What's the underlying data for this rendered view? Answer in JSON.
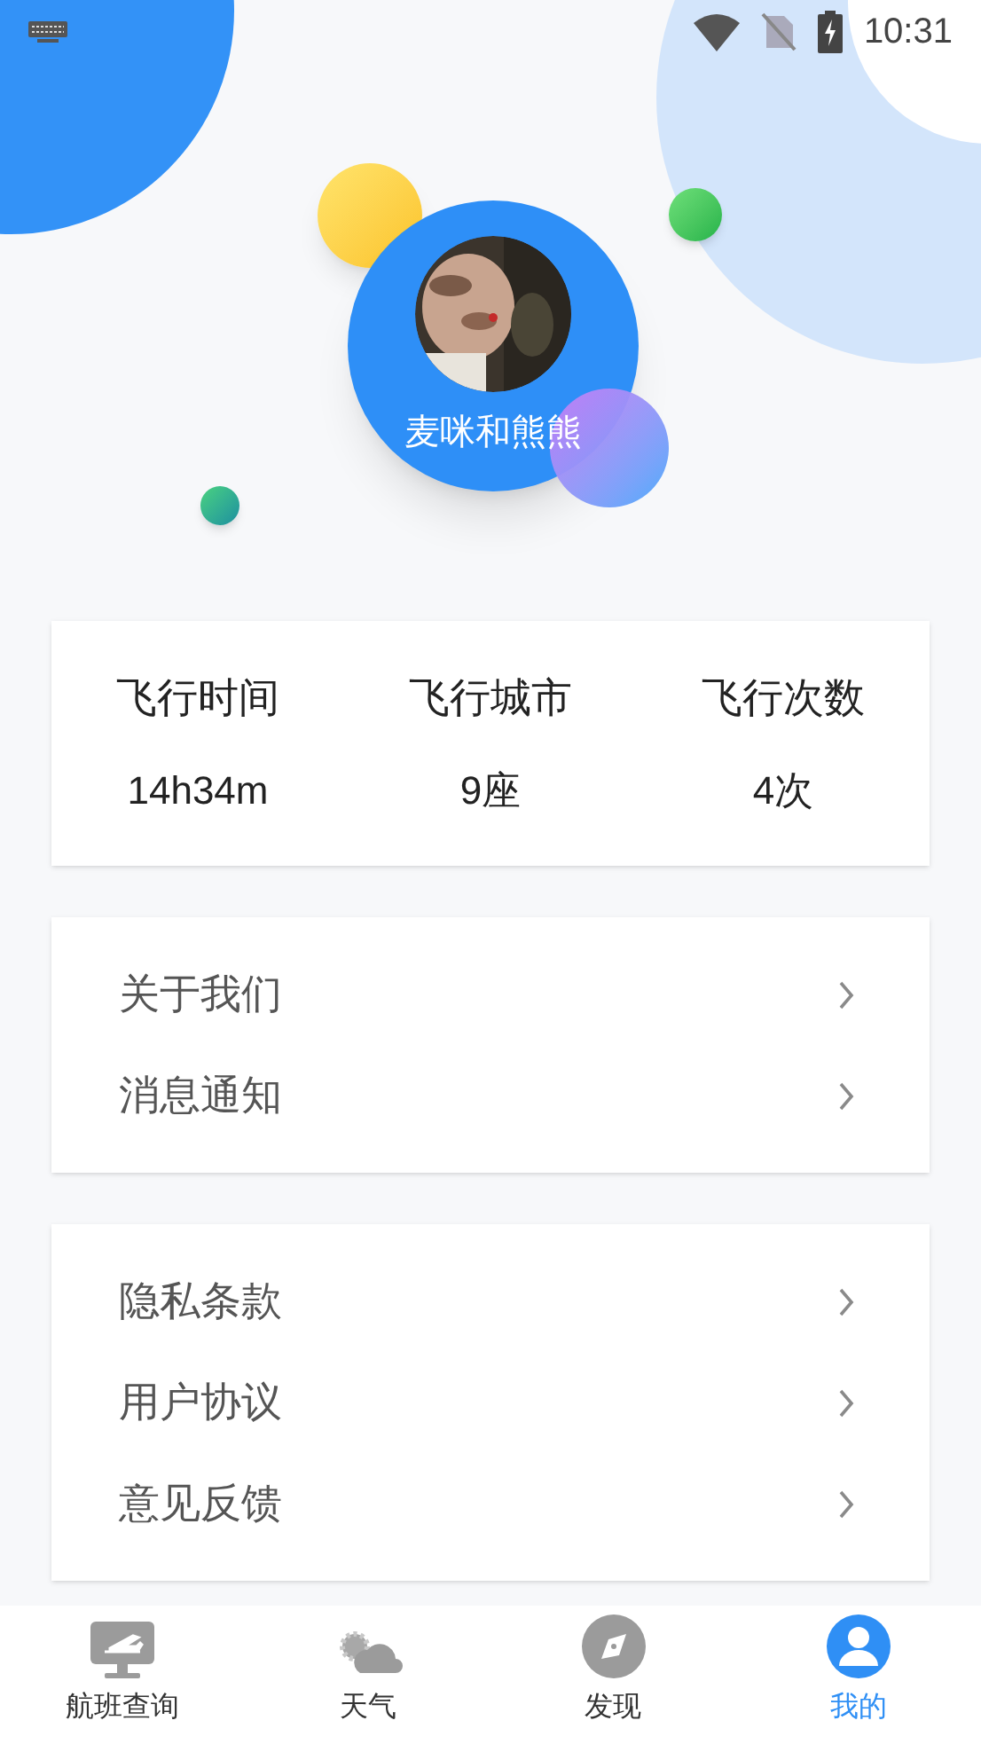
{
  "status_bar": {
    "time": "10:31"
  },
  "profile": {
    "name": "麦咪和熊熊"
  },
  "stats": [
    {
      "label": "飞行时间",
      "value": "14h34m"
    },
    {
      "label": "飞行城市",
      "value": "9座"
    },
    {
      "label": "飞行次数",
      "value": "4次"
    }
  ],
  "menu_groups": [
    [
      {
        "label": "关于我们"
      },
      {
        "label": "消息通知"
      }
    ],
    [
      {
        "label": "隐私条款"
      },
      {
        "label": "用户协议"
      },
      {
        "label": "意见反馈"
      }
    ]
  ],
  "tab_bar": [
    {
      "label": "航班查询",
      "kind": "flight",
      "selected": false
    },
    {
      "label": "天气",
      "kind": "weather",
      "selected": false
    },
    {
      "label": "发现",
      "kind": "compass",
      "selected": false
    },
    {
      "label": "我的",
      "kind": "user",
      "selected": true
    }
  ]
}
